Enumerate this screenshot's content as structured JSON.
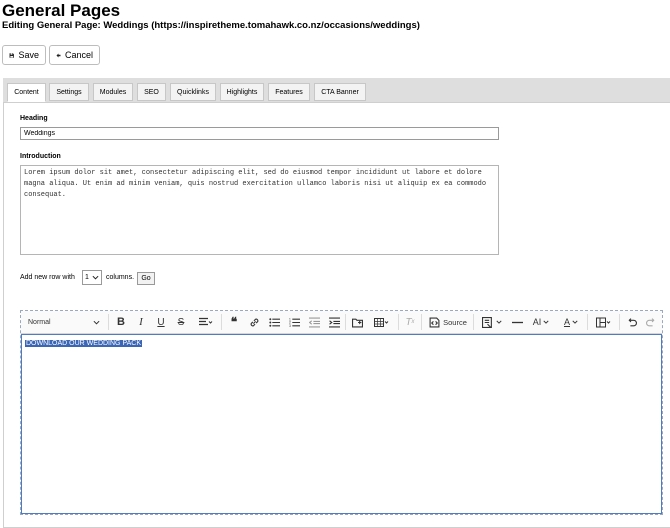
{
  "header": {
    "title": "General Pages",
    "subtitle": "Editing General Page: Weddings   (https://inspiretheme.tomahawk.co.nz/occasions/weddings)"
  },
  "actions": {
    "save": "Save",
    "cancel": "Cancel"
  },
  "tabs": [
    "Content",
    "Settings",
    "Modules",
    "SEO",
    "Quicklinks",
    "Highlights",
    "Features",
    "CTA Banner"
  ],
  "form": {
    "heading_label": "Heading",
    "heading_value": "Weddings",
    "intro_label": "Introduction",
    "intro_value": "Lorem ipsum dolor sit amet, consectetur adipiscing elit, sed do eiusmod tempor incididunt ut labore et dolore magna aliqua. Ut enim ad minim veniam, quis nostrud exercitation ullamco laboris nisi ut aliquip ex ea commodo consequat.",
    "row_prefix": "Add new row with",
    "row_columns": "1",
    "row_suffix": "columns.",
    "go": "Go"
  },
  "editor": {
    "format": "Normal",
    "source": "Source",
    "content": "DOWNLOAD OUR WEDDING PACK"
  }
}
